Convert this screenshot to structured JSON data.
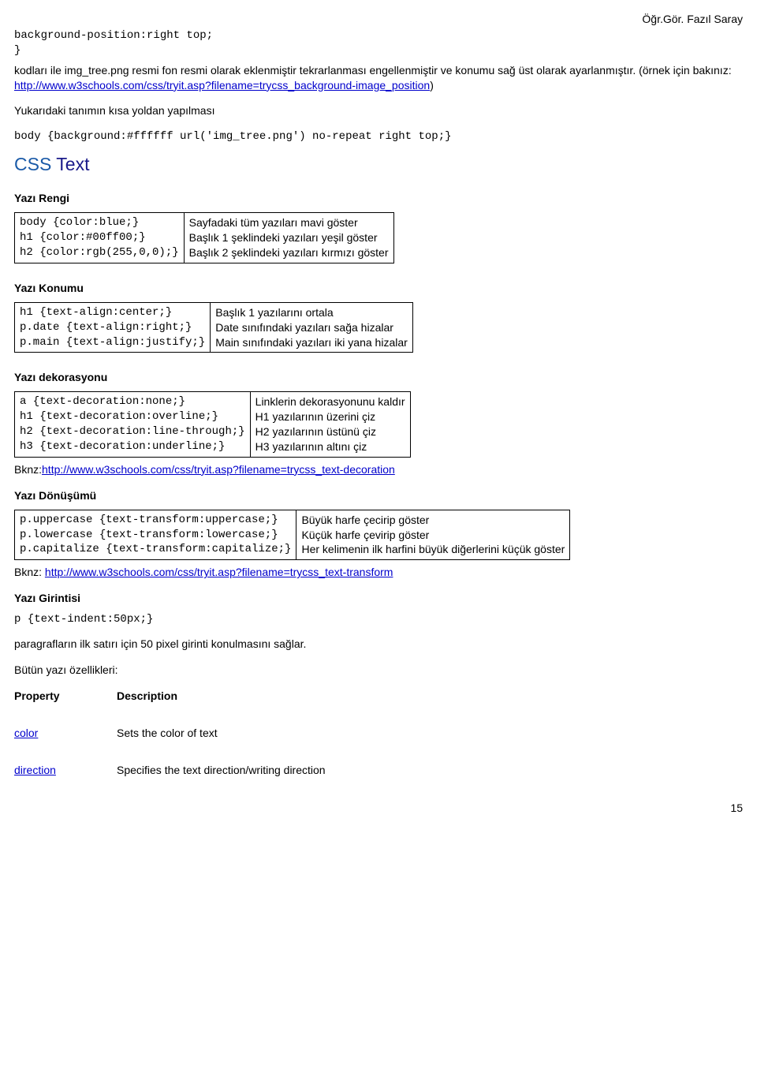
{
  "author": "Öğr.Gör. Fazıl Saray",
  "topcode": "background-position:right top;\n}",
  "p1a": "kodları ile img_tree.png resmi fon resmi olarak eklenmiştir tekrarlanması engellenmiştir ve konumu sağ üst olarak ayarlanmıştır. (örnek için bakınız: ",
  "p1link": "http://www.w3schools.com/css/tryit.asp?filename=trycss_background-image_position",
  "p1b": ")",
  "p2": "Yukarıdaki tanımın kısa yoldan yapılması",
  "shortcode": "body {background:#ffffff url('img_tree.png') no-repeat right top;}",
  "csstext": {
    "css": "CSS",
    "text": " Text"
  },
  "s1": {
    "h": "Yazı Rengi",
    "c": "body {color:blue;}\nh1 {color:#00ff00;}\nh2 {color:rgb(255,0,0);}",
    "d": "Sayfadaki tüm yazıları mavi göster\nBaşlık 1 şeklindeki yazıları yeşil göster\nBaşlık 2 şeklindeki yazıları kırmızı göster"
  },
  "s2": {
    "h": "Yazı Konumu",
    "c": "h1 {text-align:center;}\np.date {text-align:right;}\np.main {text-align:justify;}",
    "d": "Başlık 1 yazılarını ortala\nDate sınıfındaki yazıları sağa hizalar\nMain sınıfındaki yazıları iki yana hizalar"
  },
  "s3": {
    "h": "Yazı dekorasyonu",
    "c": "a {text-decoration:none;}\nh1 {text-decoration:overline;}\nh2 {text-decoration:line-through;}\nh3 {text-decoration:underline;}",
    "d": "Linklerin dekorasyonunu kaldır\nH1 yazılarının üzerini çiz\nH2 yazılarının üstünü çiz\nH3 yazılarının altını çiz"
  },
  "bknz3a": "Bknz:",
  "bknz3link": "http://www.w3schools.com/css/tryit.asp?filename=trycss_text-decoration",
  "s4": {
    "h": "Yazı Dönüşümü",
    "c": "p.uppercase {text-transform:uppercase;}\np.lowercase {text-transform:lowercase;}\np.capitalize {text-transform:capitalize;}",
    "d": "Büyük harfe çecirip göster\nKüçük harfe çevirip göster\nHer kelimenin ilk harfini büyük diğerlerini küçük göster"
  },
  "bknz4a": "Bknz: ",
  "bknz4link": "http://www.w3schools.com/css/tryit.asp?filename=trycss_text-transform",
  "s5": {
    "h": "Yazı Girintisi",
    "c": "p {text-indent:50px;}"
  },
  "p3": "paragrafların ilk satırı için 50 pixel girinti konulmasını sağlar.",
  "p4": "Bütün yazı özellikleri:",
  "thead": {
    "p": "Property",
    "d": "Description"
  },
  "row1": {
    "p": "color",
    "d": "Sets the color of text"
  },
  "row2": {
    "p": "direction",
    "d": "Specifies the text direction/writing direction"
  },
  "pagenum": "15"
}
